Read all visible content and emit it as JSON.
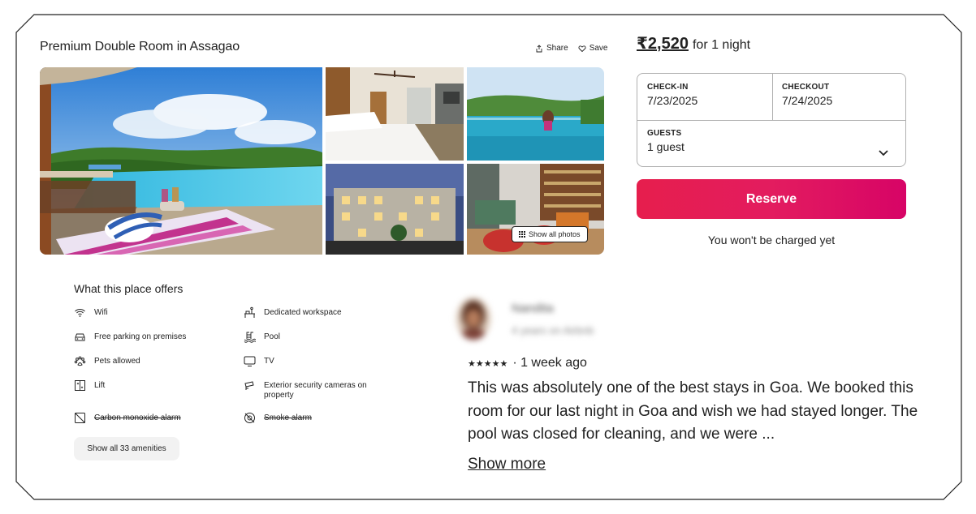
{
  "listing": {
    "title": "Premium Double Room in Assagao",
    "share_label": "Share",
    "save_label": "Save",
    "show_all_photos_label": "Show all photos"
  },
  "booking": {
    "price": "₹2,520",
    "per_night": "for 1 night",
    "checkin_label": "CHECK-IN",
    "checkin_value": "7/23/2025",
    "checkout_label": "CHECKOUT",
    "checkout_value": "7/24/2025",
    "guests_label": "GUESTS",
    "guests_value": "1 guest",
    "reserve_label": "Reserve",
    "not_charged": "You won't be charged yet",
    "accent_color": "#e61e4d"
  },
  "amenities": {
    "title": "What this place offers",
    "items": [
      {
        "label": "Wifi",
        "icon": "wifi-icon",
        "available": true
      },
      {
        "label": "Dedicated workspace",
        "icon": "workspace-icon",
        "available": true
      },
      {
        "label": "Free parking on premises",
        "icon": "car-icon",
        "available": true
      },
      {
        "label": "Pool",
        "icon": "pool-icon",
        "available": true
      },
      {
        "label": "Pets allowed",
        "icon": "paw-icon",
        "available": true
      },
      {
        "label": "TV",
        "icon": "tv-icon",
        "available": true
      },
      {
        "label": "Lift",
        "icon": "elevator-icon",
        "available": true
      },
      {
        "label": "Exterior security cameras on property",
        "icon": "security-camera-icon",
        "available": true
      },
      {
        "label": "Carbon monoxide alarm",
        "icon": "carbon-monoxide-alarm-icon",
        "available": false
      },
      {
        "label": "Smoke alarm",
        "icon": "smoke-alarm-icon",
        "available": false
      }
    ],
    "show_all_label": "Show all 33 amenities"
  },
  "review": {
    "reviewer_name": "Nandita",
    "reviewer_meta": "4 years on Airbnb",
    "stars": "★★★★★",
    "rating": 5,
    "time_ago": "· 1 week ago",
    "text": "This was absolutely one of the best stays in Goa. We booked this room for our last night in Goa and wish we had stayed longer. The pool was closed for cleaning, and we were ...",
    "show_more_label": "Show more"
  }
}
